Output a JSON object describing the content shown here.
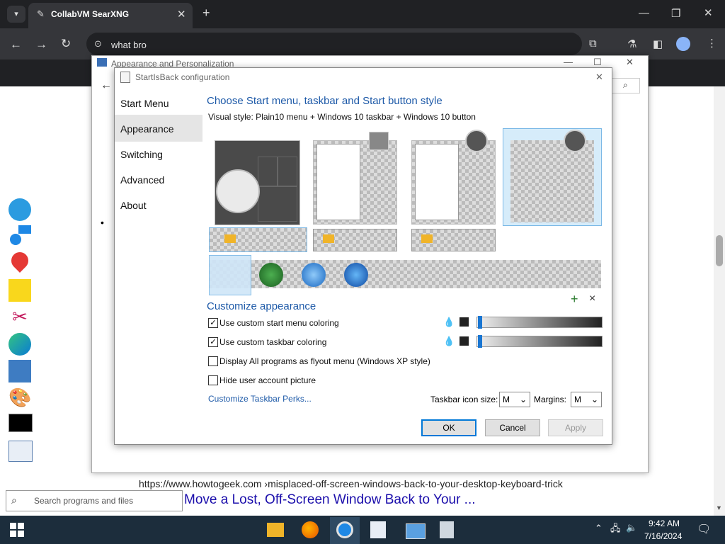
{
  "browser": {
    "tab_title": "CollabVM SearXNG",
    "url": "what bro"
  },
  "back_window": {
    "title": "Appearance and Personalization"
  },
  "dialog": {
    "title": "StartIsBack configuration",
    "nav": [
      "Start Menu",
      "Appearance",
      "Switching",
      "Advanced",
      "About"
    ],
    "selected_nav": "Appearance",
    "heading": "Choose Start menu, taskbar and Start button style",
    "visual_style": "Visual style:  Plain10 menu + Windows 10 taskbar + Windows 10 button",
    "customize_heading": "Customize appearance",
    "options": [
      {
        "label": "Use custom start menu coloring",
        "checked": true
      },
      {
        "label": "Use custom taskbar coloring",
        "checked": true
      },
      {
        "label": "Display All programs as flyout menu (Windows XP style)",
        "checked": false
      },
      {
        "label": "Hide user account picture",
        "checked": false
      }
    ],
    "perks_link": "Customize Taskbar Perks...",
    "icon_size_label": "Taskbar icon size:",
    "icon_size_value": "M",
    "margins_label": "Margins:",
    "margins_value": "M",
    "ok": "OK",
    "cancel": "Cancel",
    "apply": "Apply",
    "add_symbol": "+",
    "remove_symbol": "×"
  },
  "results": {
    "url": "https://www.howtogeek.com  ›misplaced-off-screen-windows-back-to-your-desktop-keyboard-trick",
    "title": "Move a Lost, Off-Screen Window Back to Your ..."
  },
  "taskbar": {
    "search_placeholder": "Search programs and files",
    "time": "9:42 AM",
    "date": "7/16/2024"
  },
  "colors": {
    "accent": "#1e5aa8",
    "taskbar": "#1c2d3c",
    "browser_dark": "#202124"
  }
}
